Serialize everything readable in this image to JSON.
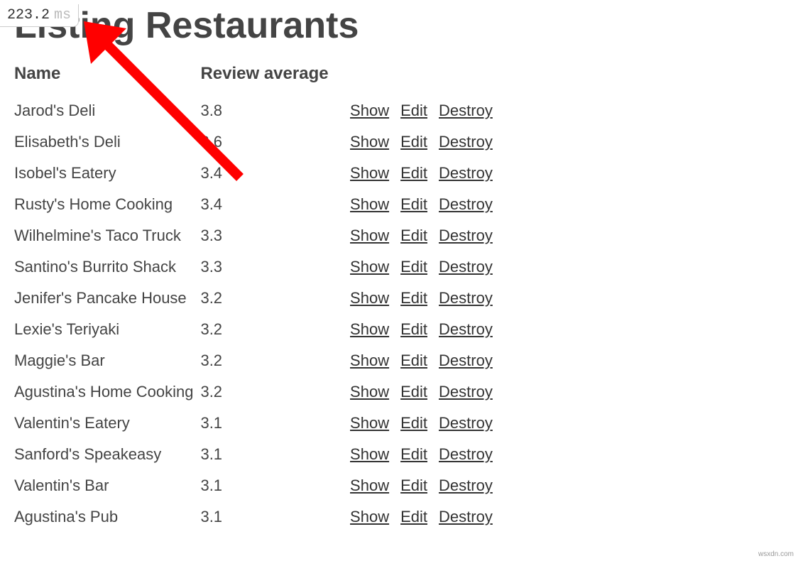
{
  "timing": {
    "value": "223.2",
    "unit": "ms"
  },
  "heading": "Listing Restaurants",
  "table": {
    "headers": {
      "name": "Name",
      "review_average": "Review average"
    },
    "rows": [
      {
        "name": "Jarod's Deli",
        "rating": "3.8"
      },
      {
        "name": "Elisabeth's Deli",
        "rating": "3.6"
      },
      {
        "name": "Isobel's Eatery",
        "rating": "3.4"
      },
      {
        "name": "Rusty's Home Cooking",
        "rating": "3.4"
      },
      {
        "name": "Wilhelmine's Taco Truck",
        "rating": "3.3"
      },
      {
        "name": "Santino's Burrito Shack",
        "rating": "3.3"
      },
      {
        "name": "Jenifer's Pancake House",
        "rating": "3.2"
      },
      {
        "name": "Lexie's Teriyaki",
        "rating": "3.2"
      },
      {
        "name": "Maggie's Bar",
        "rating": "3.2"
      },
      {
        "name": "Agustina's Home Cooking",
        "rating": "3.2"
      },
      {
        "name": "Valentin's Eatery",
        "rating": "3.1"
      },
      {
        "name": "Sanford's Speakeasy",
        "rating": "3.1"
      },
      {
        "name": "Valentin's Bar",
        "rating": "3.1"
      },
      {
        "name": "Agustina's Pub",
        "rating": "3.1"
      }
    ]
  },
  "actions": {
    "show": "Show",
    "edit": "Edit",
    "destroy": "Destroy"
  },
  "watermark": "wsxdn.com"
}
